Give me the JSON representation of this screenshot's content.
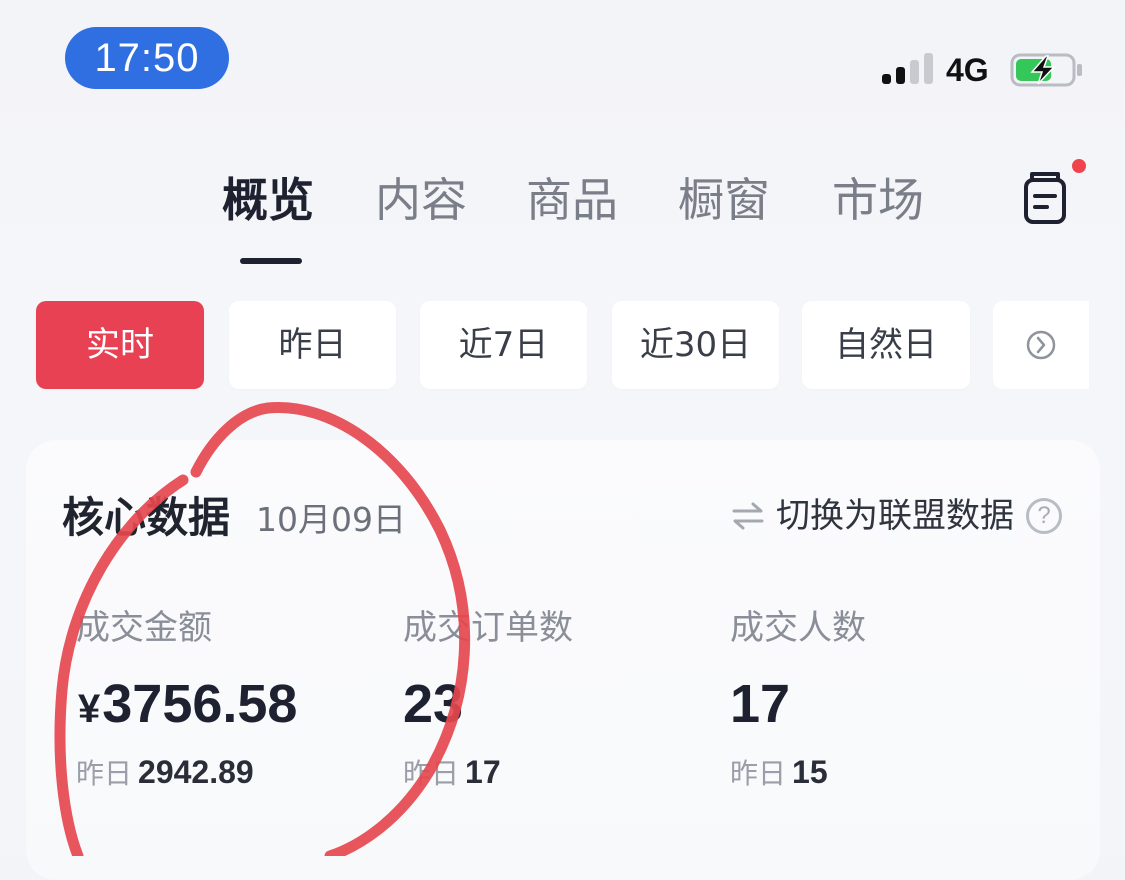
{
  "status_bar": {
    "time": "17:50",
    "network": "4G",
    "battery_state": "charging",
    "battery_level": 0.65
  },
  "tabs": [
    {
      "label": "概览",
      "active": true
    },
    {
      "label": "内容",
      "active": false
    },
    {
      "label": "商品",
      "active": false
    },
    {
      "label": "橱窗",
      "active": false
    },
    {
      "label": "市场",
      "active": false
    }
  ],
  "header": {
    "doc_icon": "document-icon",
    "has_notification_dot": true
  },
  "periods": [
    {
      "label": "实时",
      "active": true
    },
    {
      "label": "昨日",
      "active": false
    },
    {
      "label": "近7日",
      "active": false
    },
    {
      "label": "近30日",
      "active": false
    },
    {
      "label": "自然日",
      "active": false
    }
  ],
  "period_more_icon": "chevron-right-circle-icon",
  "core": {
    "title": "核心数据",
    "date": "10月09日",
    "switch_label": "切换为联盟数据",
    "help_glyph": "?",
    "metrics": [
      {
        "label": "成交金额",
        "currency": "¥",
        "value": "3756.58",
        "prev_label": "昨日",
        "prev_value": "2942.89"
      },
      {
        "label": "成交订单数",
        "currency": "",
        "value": "23",
        "prev_label": "昨日",
        "prev_value": "17"
      },
      {
        "label": "成交人数",
        "currency": "",
        "value": "17",
        "prev_label": "昨日",
        "prev_value": "15"
      }
    ]
  },
  "colors": {
    "accent": "#e84154",
    "time_pill": "#2f6fe2",
    "annotation": "#e5484e",
    "battery": "#34c759"
  }
}
